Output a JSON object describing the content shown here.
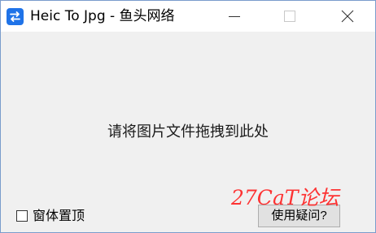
{
  "window": {
    "title": "Heic To Jpg - 鱼头网络",
    "icon": "swap-arrows-icon",
    "controls": [
      "minimize",
      "maximize",
      "close"
    ]
  },
  "main": {
    "drop_hint": "请将图片文件拖拽到此处"
  },
  "footer": {
    "topmost_label": "窗体置顶",
    "topmost_checked": false,
    "help_button_label": "使用疑问?"
  },
  "watermark": {
    "text": "27CaT论坛",
    "color": "#ff1f1f"
  },
  "colors": {
    "app_icon_bg": "#1f73e8",
    "client_bg": "#f0f0f0",
    "titlebar_bg": "#ffffff"
  }
}
